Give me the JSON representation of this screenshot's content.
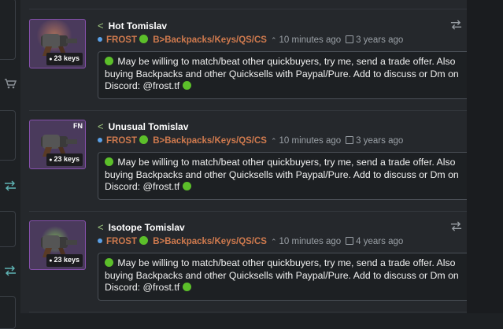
{
  "left_edge": {
    "cart_icon": "cart-icon",
    "swap_icon": "swap-icon"
  },
  "listings": [
    {
      "item_name": "Hot Tomislav",
      "price": "23 keys",
      "badge": "",
      "glow_color": "#c06a40",
      "username": "FROST",
      "trade_info": "B>Backpacks/Keys/QS/CS",
      "bumped": "10 minutes ago",
      "created": "3 years ago",
      "description": "May be willing to match/beat other quickbuyers, try me, send a trade offer. Also buying Backpacks and other Quicksells with Paypal/Pure. Add to discuss or Dm on Discord: @frost.tf",
      "actions": [
        "swap-icon",
        "swap-icon-teal"
      ]
    },
    {
      "item_name": "Unusual Tomislav",
      "price": "23 keys",
      "badge": "FN",
      "glow_color": "",
      "username": "FROST",
      "trade_info": "B>Backpacks/Keys/QS/CS",
      "bumped": "10 minutes ago",
      "created": "3 years ago",
      "description": "May be willing to match/beat other quickbuyers, try me, send a trade offer. Also buying Backpacks and other Quicksells with Paypal/Pure. Add to discuss or Dm on Discord: @frost.tf",
      "actions": [
        "swap-icon"
      ]
    },
    {
      "item_name": "Isotope Tomislav",
      "price": "23 keys",
      "badge": "",
      "glow_color": "#6fcf3a",
      "username": "FROST",
      "trade_info": "B>Backpacks/Keys/QS/CS",
      "bumped": "10 minutes ago",
      "created": "4 years ago",
      "description": "May be willing to match/beat other quickbuyers, try me, send a trade offer. Also buying Backpacks and other Quicksells with Paypal/Pure. Add to discuss or Dm on Discord: @frost.tf",
      "actions": [
        "swap-icon",
        "swap-icon-teal"
      ]
    }
  ],
  "colors": {
    "quality_border": "#8650AC",
    "username": "#cf7a4e",
    "online": "#5cbf2a",
    "swap_grey": "#9aa0a6",
    "swap_teal": "#5fb3b3"
  }
}
